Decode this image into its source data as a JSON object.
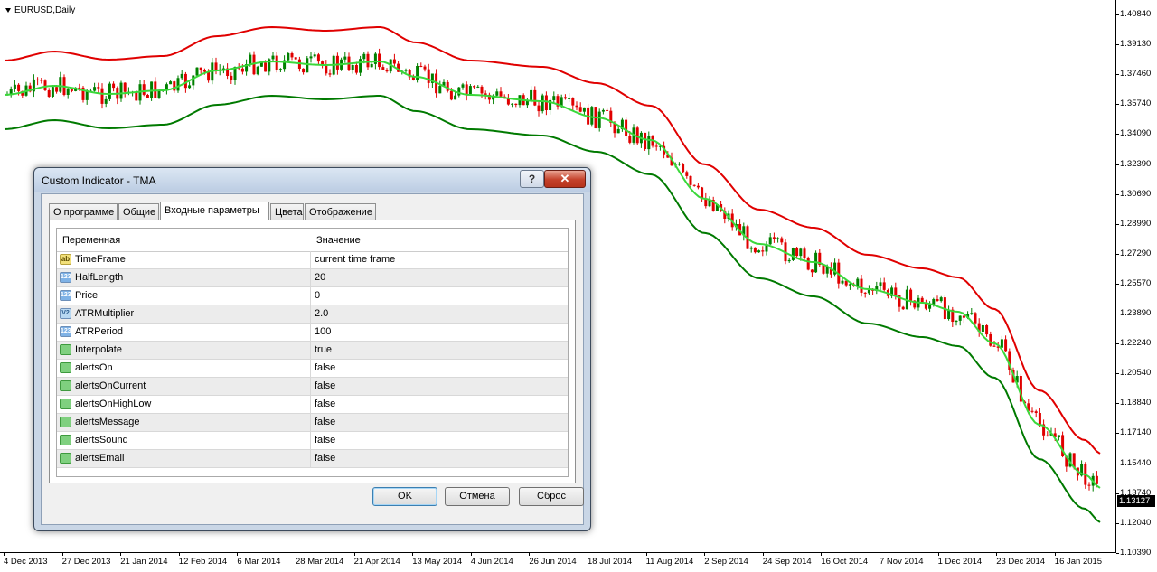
{
  "chart": {
    "symbol_title": "EURUSD,Daily",
    "current_price": "1.13127",
    "price_ticks": [
      "1.40840",
      "1.39130",
      "1.37460",
      "1.35740",
      "1.34090",
      "1.32390",
      "1.30690",
      "1.28990",
      "1.27290",
      "1.25570",
      "1.23890",
      "1.22240",
      "1.20540",
      "1.18840",
      "1.17140",
      "1.15440",
      "1.13740",
      "1.12040",
      "1.10390"
    ],
    "time_ticks": [
      "4 Dec 2013",
      "27 Dec 2013",
      "21 Jan 2014",
      "12 Feb 2014",
      "6 Mar 2014",
      "28 Mar 2014",
      "21 Apr 2014",
      "13 May 2014",
      "4 Jun 2014",
      "26 Jun 2014",
      "18 Jul 2014",
      "11 Aug 2014",
      "2 Sep 2014",
      "24 Sep 2014",
      "16 Oct 2014",
      "7 Nov 2014",
      "1 Dec 2014",
      "23 Dec 2014",
      "16 Jan 2015"
    ],
    "colors": {
      "bull": "#008000",
      "bear": "#e00000",
      "upper_band": "#e00000",
      "mid_line": "#3ad83a",
      "lower_band": "#007a00"
    },
    "ylim": [
      1.1039,
      1.4084
    ]
  },
  "dialog": {
    "title": "Custom Indicator - TMA",
    "help_label": "?",
    "close_label": "✕",
    "tabs": [
      {
        "label": "О программе"
      },
      {
        "label": "Общие"
      },
      {
        "label": "Входные параметры"
      },
      {
        "label": "Цвета"
      },
      {
        "label": "Отображение"
      }
    ],
    "active_tab": "Входные параметры",
    "grid": {
      "col_variable": "Переменная",
      "col_value": "Значение",
      "rows": [
        {
          "icon": "ab",
          "name": "TimeFrame",
          "value": "current time frame"
        },
        {
          "icon": "123",
          "name": "HalfLength",
          "value": "20"
        },
        {
          "icon": "123",
          "name": "Price",
          "value": "0"
        },
        {
          "icon": "V2",
          "name": "ATRMultiplier",
          "value": "2.0"
        },
        {
          "icon": "123",
          "name": "ATRPeriod",
          "value": "100"
        },
        {
          "icon": "bool",
          "name": "Interpolate",
          "value": "true"
        },
        {
          "icon": "bool",
          "name": "alertsOn",
          "value": "false"
        },
        {
          "icon": "bool",
          "name": "alertsOnCurrent",
          "value": "false"
        },
        {
          "icon": "bool",
          "name": "alertsOnHighLow",
          "value": "false"
        },
        {
          "icon": "bool",
          "name": "alertsMessage",
          "value": "false"
        },
        {
          "icon": "bool",
          "name": "alertsSound",
          "value": "false"
        },
        {
          "icon": "bool",
          "name": "alertsEmail",
          "value": "false"
        }
      ]
    },
    "buttons": {
      "ok": "OK",
      "cancel": "Отмена",
      "reset": "Сброс"
    }
  }
}
